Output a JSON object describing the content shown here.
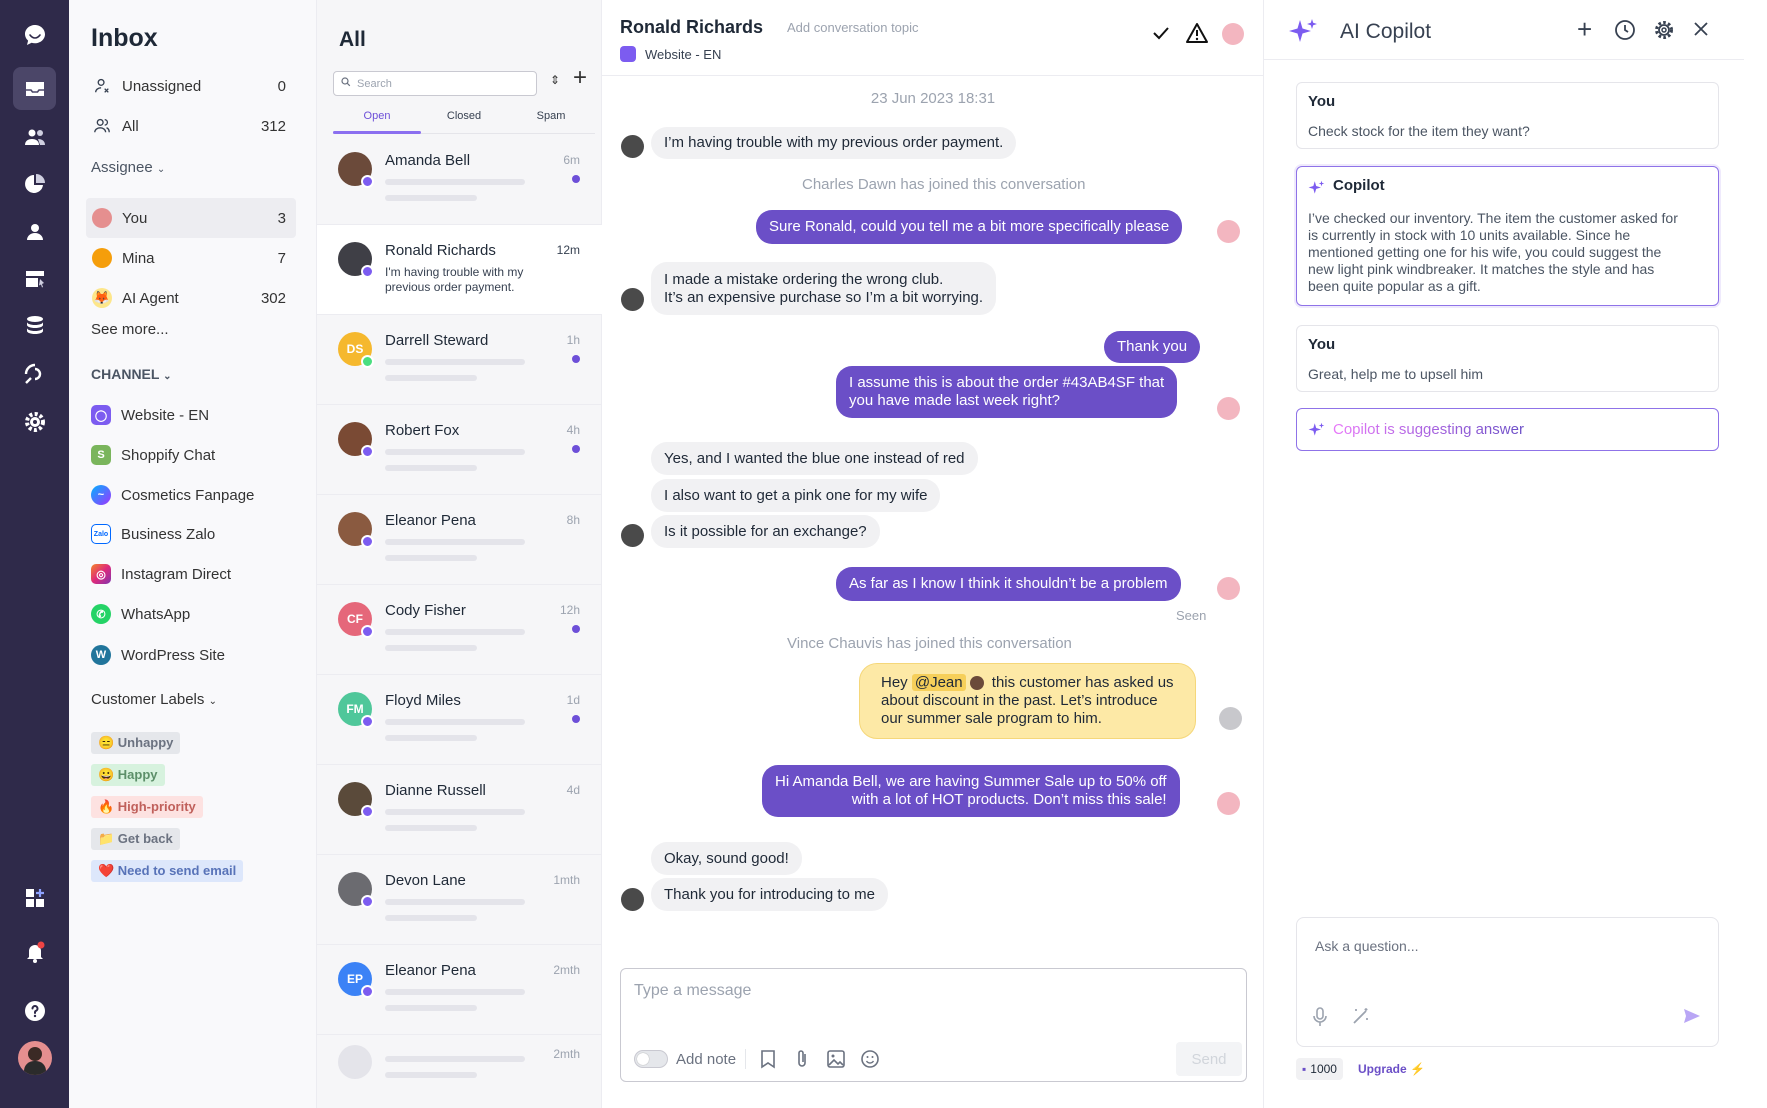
{
  "colors": {
    "rail": "#2f2a4a",
    "accent": "#6b4fc7",
    "note": "#fde9a6"
  },
  "inbox": {
    "title": "Inbox",
    "rows": [
      {
        "label": "Unassigned",
        "count": "0"
      },
      {
        "label": "All",
        "count": "312"
      }
    ],
    "assignee_header": "Assignee",
    "assignees": [
      {
        "label": "You",
        "count": "3"
      },
      {
        "label": "Mina",
        "count": "7"
      },
      {
        "label": "AI Agent",
        "count": "302"
      }
    ],
    "see_more": "See more...",
    "channel_header": "CHANNEL",
    "channels": [
      "Website - EN",
      "Shoppify Chat",
      "Cosmetics Fanpage",
      "Business Zalo",
      "Instagram Direct",
      "WhatsApp",
      "WordPress Site"
    ],
    "labels_header": "Customer Labels",
    "labels": [
      "😑 Unhappy",
      "😀 Happy",
      "🔥 High-priority",
      "📁 Get back",
      "❤️ Need to send email"
    ]
  },
  "convlist": {
    "title": "All",
    "search_placeholder": "Search",
    "tabs": [
      "Open",
      "Closed",
      "Spam"
    ],
    "items": [
      {
        "name": "Amanda Bell",
        "time": "6m",
        "initials": ""
      },
      {
        "name": "Ronald Richards",
        "time": "12m",
        "preview": "I'm having trouble with my previous order payment.",
        "initials": ""
      },
      {
        "name": "Darrell Steward",
        "time": "1h",
        "initials": "DS"
      },
      {
        "name": "Robert Fox",
        "time": "4h",
        "initials": ""
      },
      {
        "name": "Eleanor Pena",
        "time": "8h",
        "initials": ""
      },
      {
        "name": "Cody Fisher",
        "time": "12h",
        "initials": "CF"
      },
      {
        "name": "Floyd Miles",
        "time": "1d",
        "initials": "FM"
      },
      {
        "name": "Dianne Russell",
        "time": "4d",
        "initials": ""
      },
      {
        "name": "Devon Lane",
        "time": "1mth",
        "initials": ""
      },
      {
        "name": "Eleanor Pena",
        "time": "2mth",
        "initials": "EP"
      },
      {
        "name": "",
        "time": "2mth",
        "initials": ""
      }
    ]
  },
  "chat": {
    "name": "Ronald Richards",
    "topic": "Add conversation topic",
    "channel": "Website - EN",
    "date": "23 Jun 2023 18:31",
    "messages": {
      "m1": "I’m having trouble with my previous order payment.",
      "sys1": "Charles Dawn has joined this conversation",
      "m2": "Sure Ronald, could you tell me a bit more specifically please",
      "m3a": "I made a mistake ordering the wrong club.",
      "m3b": "It’s an expensive purchase so I’m a bit worrying.",
      "m4": "Thank you",
      "m5a": "I assume this is about the order #43AB4SF that",
      "m5b": "you have made last week right?",
      "m6": "Yes, and I wanted the blue one instead of red",
      "m7": "I also want to get a pink one for my wife",
      "m8": "Is it possible for an exchange?",
      "m9": "As far as I know I think it shouldn’t be a problem",
      "seen": "Seen",
      "sys2": "Vince Chauvis has joined this conversation",
      "note_pre": "Hey",
      "note_mention": "@Jean",
      "note_post": "this customer has asked us",
      "note_b": "about discount in the past. Let’s introduce",
      "note_c": "our summer sale program to him.",
      "m10a": "Hi Amanda Bell, we are having Summer Sale up to 50% off",
      "m10b": "with a lot of HOT products. Don’t miss this sale!",
      "m11": "Okay, sound good!",
      "m12": "Thank you for introducing to me"
    },
    "composer_placeholder": "Type a message",
    "add_note": "Add note",
    "send": "Send"
  },
  "copilot": {
    "title": "AI Copilot",
    "cards": [
      {
        "who": "You",
        "text": "Check stock for the item they want?"
      },
      {
        "who": "Copilot",
        "lines": [
          "I’ve checked our inventory. The item the customer asked for",
          "is currently in stock with 10 units available. Since he",
          "mentioned getting one for his wife, you could suggest the",
          "new light pink windbreaker. It matches the style and has",
          "been quite popular as a gift."
        ]
      },
      {
        "who": "You",
        "text": "Great, help me to upsell him"
      }
    ],
    "suggesting": "Copilot is suggesting answer",
    "ask_placeholder": "Ask a question...",
    "credits": "1000",
    "upgrade": "Upgrade"
  }
}
